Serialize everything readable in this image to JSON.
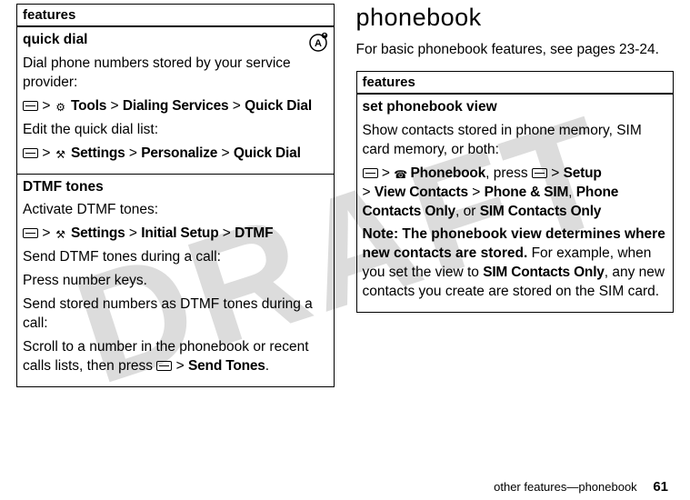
{
  "watermark": "DRAFT",
  "left": {
    "header": "features",
    "section1": {
      "title": "quick dial",
      "p1": "Dial phone numbers stored by your service provider:",
      "path1_tools": "Tools",
      "path1_dialing": "Dialing Services",
      "path1_quick": "Quick Dial",
      "p2": "Edit the quick dial list:",
      "path2_settings": "Settings",
      "path2_personalize": "Personalize",
      "path2_quick": "Quick Dial"
    },
    "section2": {
      "title": "DTMF tones",
      "p1": "Activate DTMF tones:",
      "path1_settings": "Settings",
      "path1_initial": "Initial Setup",
      "path1_dtmf": "DTMF",
      "p2": "Send DTMF tones during a call:",
      "p3": "Press number keys.",
      "p4": "Send stored numbers as DTMF tones during a call:",
      "p5a": "Scroll to a number in the phonebook or recent calls lists, then press ",
      "p5_send": "Send Tones",
      "p5_dot": "."
    }
  },
  "right": {
    "title": "phonebook",
    "intro": "For basic phonebook features, see pages 23-24.",
    "header": "features",
    "section1": {
      "title": "set phonebook view",
      "p1": "Show contacts stored in phone memory, SIM card memory, or both:",
      "path_pb": "Phonebook",
      "path_press": ", press ",
      "path_setup": "Setup",
      "path_view": "View Contacts",
      "path_phone_sim": "Phone & SIM",
      "path_sep1": ", ",
      "path_pco": "Phone Contacts Only",
      "path_sep2": ", or ",
      "path_sco": "SIM Contacts Only",
      "note_bold": "Note: The phonebook view determines where new contacts are stored.",
      "note_rest1": " For example, when you set the view to ",
      "note_sco": "SIM Contacts Only",
      "note_rest2": ", any new contacts you create are stored on the SIM card."
    }
  },
  "footer": {
    "text": "other features—phonebook",
    "page": "61"
  },
  "gt": ">"
}
